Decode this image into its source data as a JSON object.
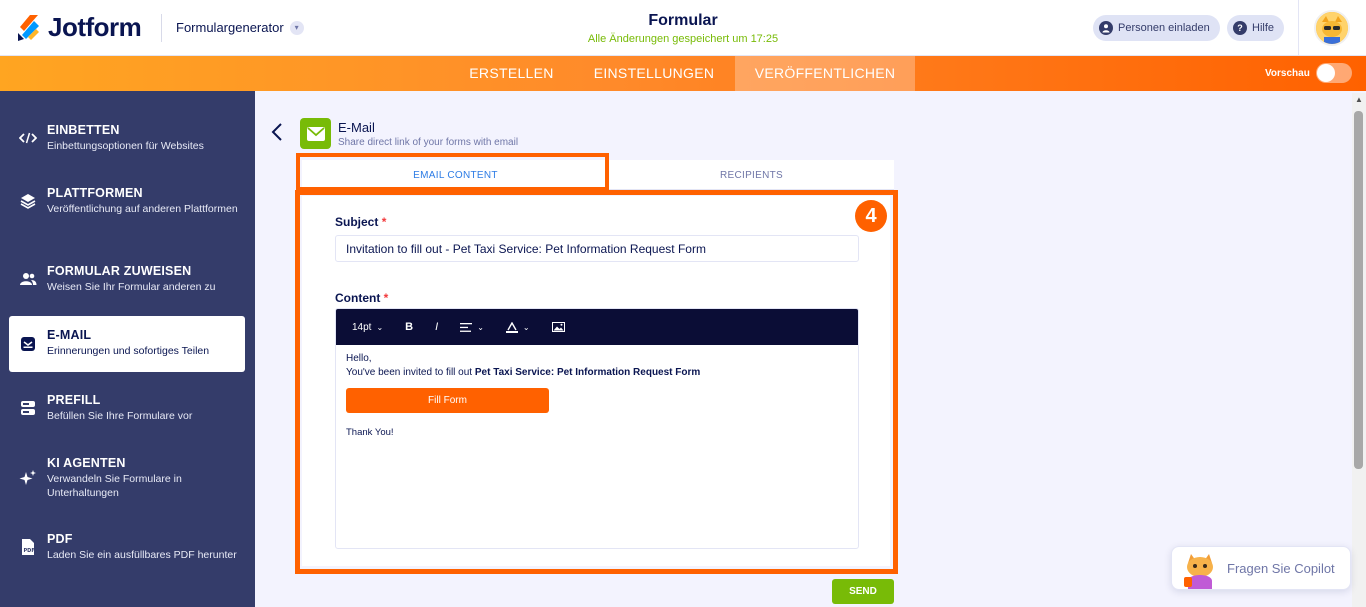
{
  "header": {
    "logo_text": "Jotform",
    "builder_selector": "Formulargenerator",
    "form_title": "Formular",
    "saved_message": "Alle Änderungen gespeichert um 17:25",
    "invite_label": "Personen einladen",
    "help_label": "Hilfe"
  },
  "nav": {
    "tabs": [
      {
        "label": "ERSTELLEN"
      },
      {
        "label": "EINSTELLUNGEN"
      },
      {
        "label": "VERÖFFENTLICHEN"
      }
    ],
    "active_tab": "VERÖFFENTLICHEN",
    "preview_label": "Vorschau",
    "preview_on": false
  },
  "sidebar": {
    "items": [
      {
        "title": "EINBETTEN",
        "subtitle": "Einbettungsoptionen für Websites",
        "icon": "code-icon"
      },
      {
        "title": "PLATTFORMEN",
        "subtitle": "Veröffentlichung auf anderen Plattformen",
        "icon": "layers-icon"
      },
      {
        "title": "FORMULAR ZUWEISEN",
        "subtitle": "Weisen Sie Ihr Formular anderen zu",
        "icon": "users-icon"
      },
      {
        "title": "E-MAIL",
        "subtitle": "Erinnerungen und sofortiges Teilen",
        "icon": "mail-icon"
      },
      {
        "title": "PREFILL",
        "subtitle": "Befüllen Sie Ihre Formulare vor",
        "icon": "database-icon"
      },
      {
        "title": "KI AGENTEN",
        "subtitle": "Verwandeln Sie Formulare in Unterhaltungen",
        "icon": "sparkle-icon"
      },
      {
        "title": "PDF",
        "subtitle": "Laden Sie ein ausfüllbares PDF herunter",
        "icon": "pdf-icon"
      }
    ],
    "active_item": "E-MAIL"
  },
  "email": {
    "title": "E-Mail",
    "subtitle": "Share direct link of your forms with email",
    "tabs": [
      {
        "label": "EMAIL CONTENT"
      },
      {
        "label": "RECIPIENTS"
      }
    ],
    "active_tab": "EMAIL CONTENT",
    "step_number": "4",
    "subject_label": "Subject",
    "required_mark": "*",
    "subject_value": "Invitation to fill out - Pet Taxi Service: Pet Information Request Form",
    "content_label": "Content",
    "toolbar": {
      "font_size": "14pt",
      "bold": "B",
      "italic": "I"
    },
    "body": {
      "greeting": "Hello,",
      "invite_prefix": "You've been invited to fill out ",
      "form_name": "Pet Taxi Service: Pet Information Request Form",
      "button_label": "Fill Form",
      "closing": "Thank You!"
    },
    "send_label": "SEND"
  },
  "copilot": {
    "label": "Fragen Sie Copilot"
  },
  "colors": {
    "accent_orange": "#ff6100",
    "sidebar_bg": "#343c6a",
    "green": "#78bb07",
    "link_blue": "#2d7ce5"
  }
}
